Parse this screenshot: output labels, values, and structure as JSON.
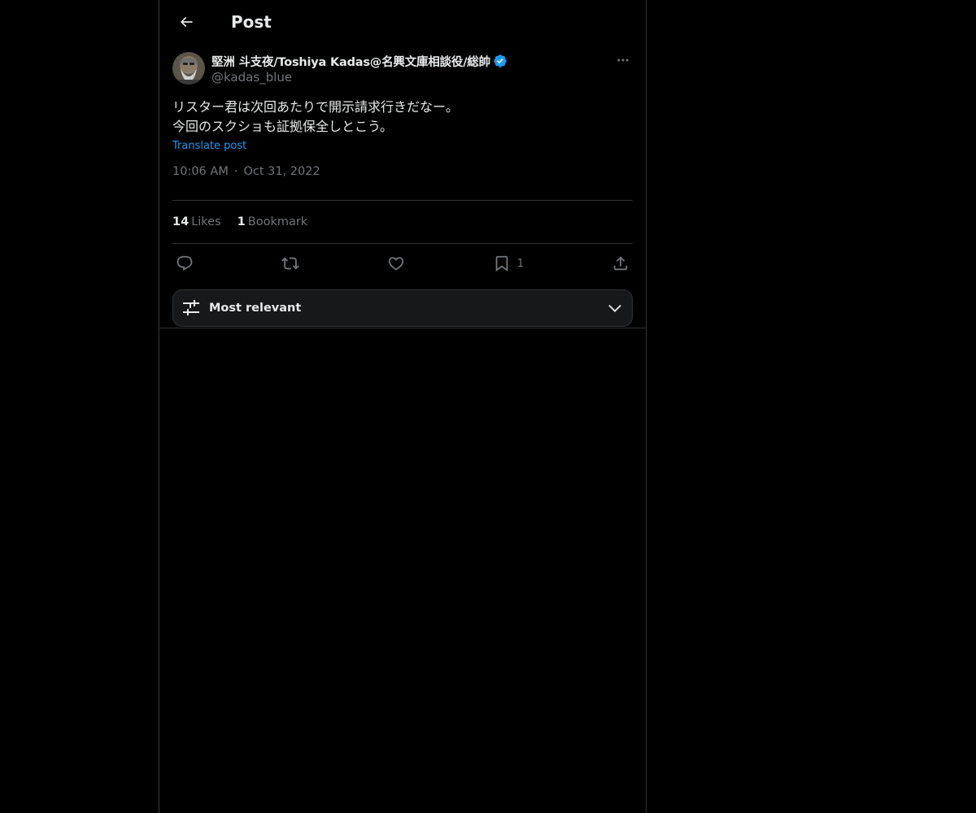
{
  "header": {
    "title": "Post",
    "back_icon": "arrow-left-icon"
  },
  "post": {
    "author": {
      "display_name": "堅洲 斗支夜/Toshiya Kadas@名興文庫相談役/総帥",
      "handle": "@kadas_blue",
      "verified": true,
      "verified_color": "#1d9bf0"
    },
    "text": "リスター君は次回あたりで開示請求行きだなー。\n今回のスクショも証拠保全しとこう。",
    "translate_label": "Translate post",
    "time": "10:06 AM",
    "separator": "·",
    "date": "Oct 31, 2022",
    "stats": {
      "likes_count": "14",
      "likes_label": "Likes",
      "bookmarks_count": "1",
      "bookmarks_label": "Bookmark"
    },
    "actions": {
      "bookmark_count": "1"
    }
  },
  "replies_sort": {
    "label": "Most relevant"
  },
  "colors": {
    "background": "#000000",
    "border": "#2f3336",
    "primary_text": "#e7e9ea",
    "secondary_text": "#71767b",
    "accent": "#1d9bf0"
  }
}
